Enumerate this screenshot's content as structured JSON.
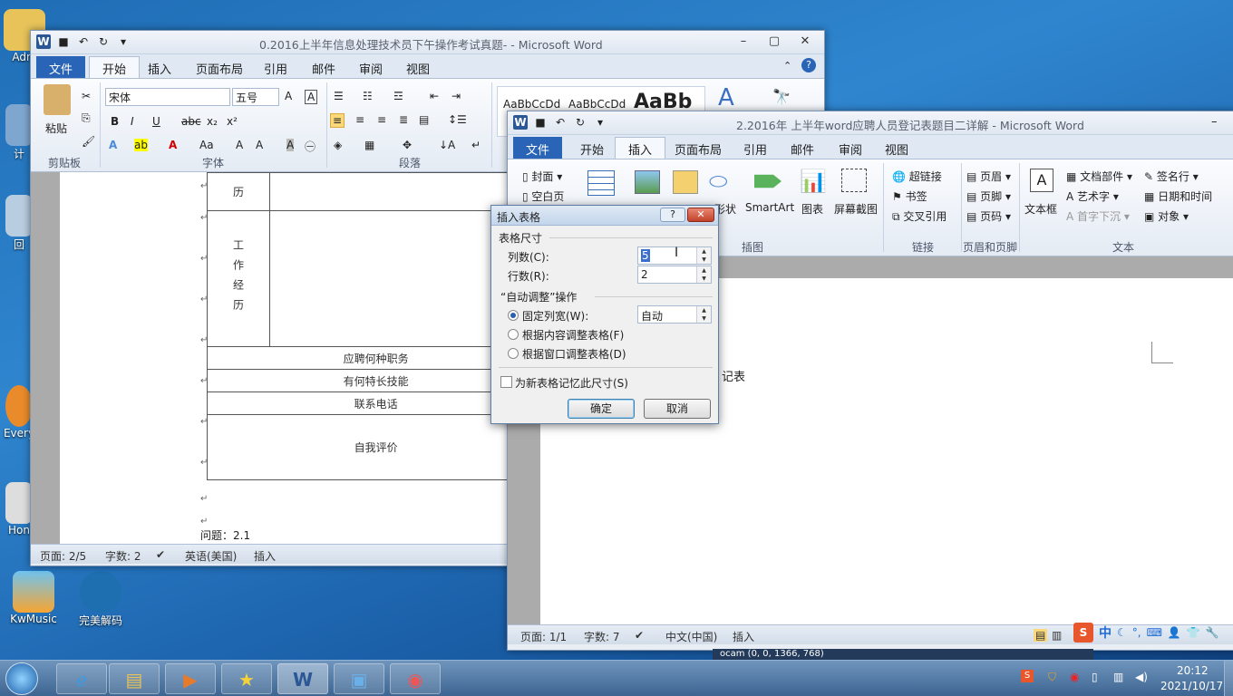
{
  "desktop": {
    "icons": [
      {
        "label": "Adm"
      },
      {
        "label": "计"
      },
      {
        "label": "回"
      },
      {
        "label": "Every"
      },
      {
        "label": "Hon"
      },
      {
        "label": "KwMusic"
      },
      {
        "label": "完美解码"
      }
    ]
  },
  "word1": {
    "title": "0.2016上半年信息处理技术员下午操作考试真题- - Microsoft Word",
    "tabs": [
      "文件",
      "开始",
      "插入",
      "页面布局",
      "引用",
      "邮件",
      "审阅",
      "视图"
    ],
    "font_name": "宋体",
    "font_size": "五号",
    "paste": "粘贴",
    "groups": {
      "clipboard": "剪贴板",
      "font": "字体",
      "paragraph": "段落"
    },
    "styles": [
      "AaBbCcDd",
      "AaBbCcDd",
      "AaBb"
    ],
    "table_rows": [
      "工作经历",
      "应聘何种职务",
      "有何特长技能",
      "联系电话",
      "自我评价"
    ],
    "row_top": "历",
    "question": "问题：2.1",
    "status": {
      "page": "页面: 2/5",
      "words": "字数: 2",
      "lang": "英语(美国)",
      "mode": "插入"
    }
  },
  "word2": {
    "title": "2.2016年 上半年word应聘人员登记表题目二详解 - Microsoft Word",
    "tabs": [
      "文件",
      "开始",
      "插入",
      "页面布局",
      "引用",
      "邮件",
      "审阅",
      "视图"
    ],
    "pages": [
      "封面",
      "空白页"
    ],
    "illus": [
      "形状",
      "SmartArt",
      "图表",
      "屏幕截图"
    ],
    "links": [
      "超链接",
      "书签",
      "交叉引用"
    ],
    "hf": [
      "页眉",
      "页脚",
      "页码"
    ],
    "text": [
      "文本框",
      "文档部件",
      "艺术字",
      "首字下沉",
      "签名行",
      "日期和时间",
      "对象"
    ],
    "groups": {
      "illus": "插图",
      "links": "链接",
      "hf": "页眉和页脚",
      "text": "文本"
    },
    "doc_text": "记表",
    "status": {
      "page": "页面: 1/1",
      "words": "字数: 7",
      "lang": "中文(中国)",
      "mode": "插入"
    }
  },
  "dialog": {
    "title": "插入表格",
    "help": "?",
    "size_label": "表格尺寸",
    "cols_label": "列数(C):",
    "cols_value": "5",
    "rows_label": "行数(R):",
    "rows_value": "2",
    "autofit_label": "“自动调整”操作",
    "opt_fixed": "固定列宽(W):",
    "fixed_value": "自动",
    "opt_content": "根据内容调整表格(F)",
    "opt_window": "根据窗口调整表格(D)",
    "remember": "为新表格记忆此尺寸(S)",
    "ok": "确定",
    "cancel": "取消"
  },
  "taskbar": {
    "clock_time": "20:12",
    "clock_date": "2021/10/17",
    "ime": "中",
    "hidden_title": "ocam (0, 0, 1366, 768)"
  }
}
